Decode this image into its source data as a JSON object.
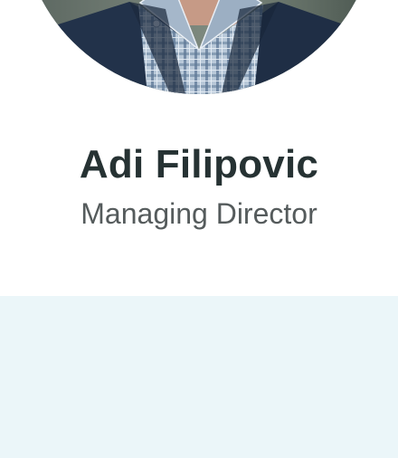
{
  "profile": {
    "name": "Adi Filipovic",
    "role": "Managing Director",
    "photo_alt": "Portrait of Adi Filipovic"
  },
  "colors": {
    "name_text": "#263233",
    "role_text": "#555b5c",
    "band_background": "#ebf6f9",
    "jacket": "#22324a",
    "shirt": "#9fb3c8"
  }
}
